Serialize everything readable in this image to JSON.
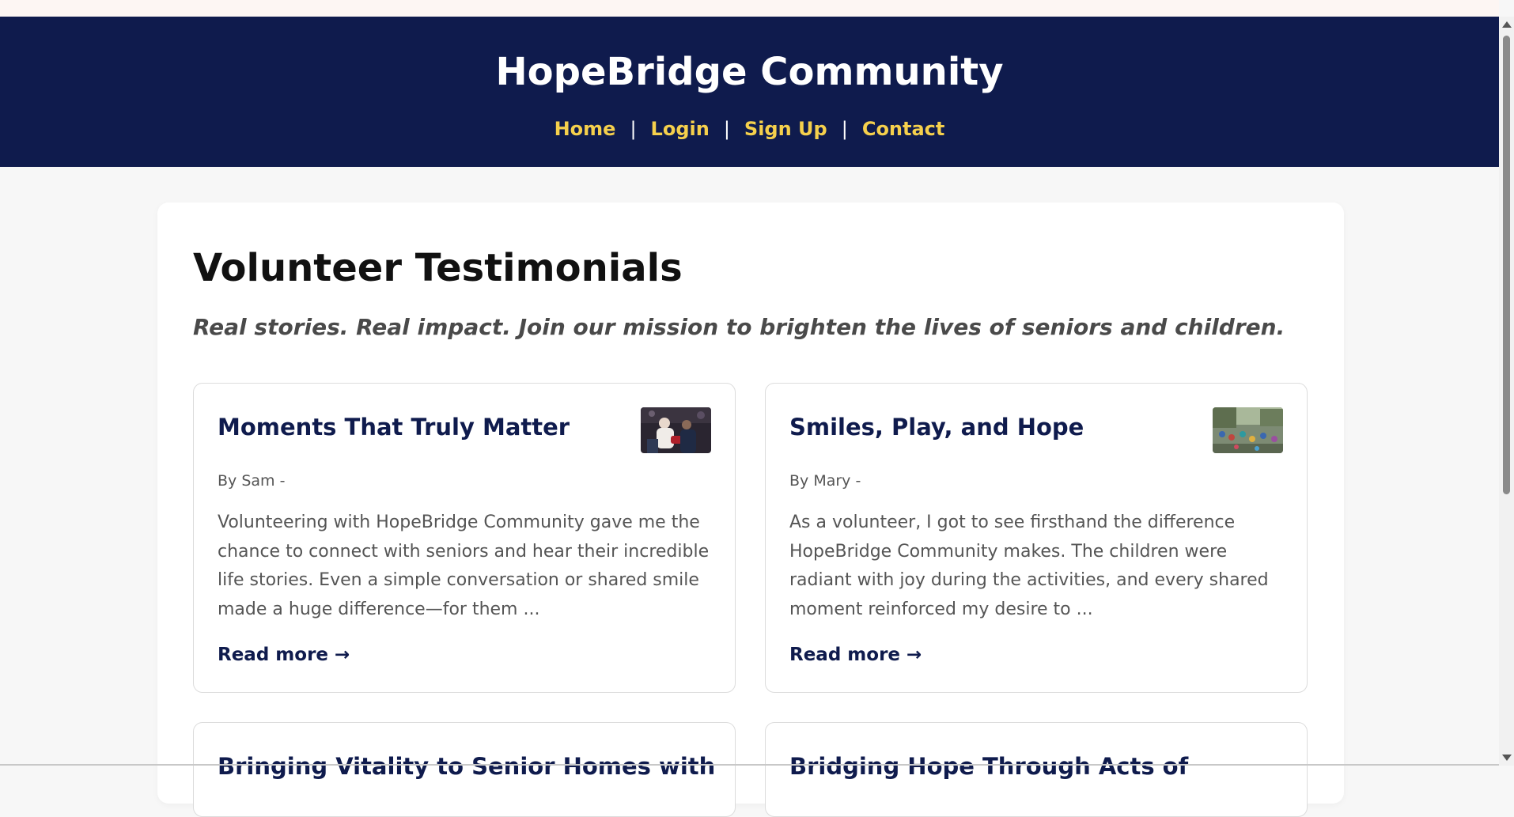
{
  "header": {
    "site_title": "HopeBridge Community",
    "nav": [
      {
        "label": "Home"
      },
      {
        "label": "Login"
      },
      {
        "label": "Sign Up"
      },
      {
        "label": "Contact"
      }
    ],
    "separator": "|"
  },
  "main": {
    "title": "Volunteer Testimonials",
    "tagline": "Real stories. Real impact. Join our mission to brighten the lives of seniors and children.",
    "testimonials": [
      {
        "title": "Moments That Truly Matter",
        "author": "By Sam -",
        "excerpt": "Volunteering with HopeBridge Community gave me the chance to connect with seniors and hear their incredible life stories. Even a simple conversation or shared smile made a huge difference—for them ...",
        "read_more": "Read more →"
      },
      {
        "title": "Smiles, Play, and Hope",
        "author": "By Mary -",
        "excerpt": "As a volunteer, I got to see firsthand the difference HopeBridge Community makes. The children were radiant with joy during the activities, and every shared moment reinforced my desire to ...",
        "read_more": "Read more →"
      },
      {
        "title": "Bringing Vitality to Senior Homes with"
      },
      {
        "title": "Bridging Hope Through Acts of"
      }
    ]
  },
  "colors": {
    "header_bg": "#0f1b4d",
    "nav_link": "#f5d04c",
    "card_title": "#0f1b4d"
  }
}
